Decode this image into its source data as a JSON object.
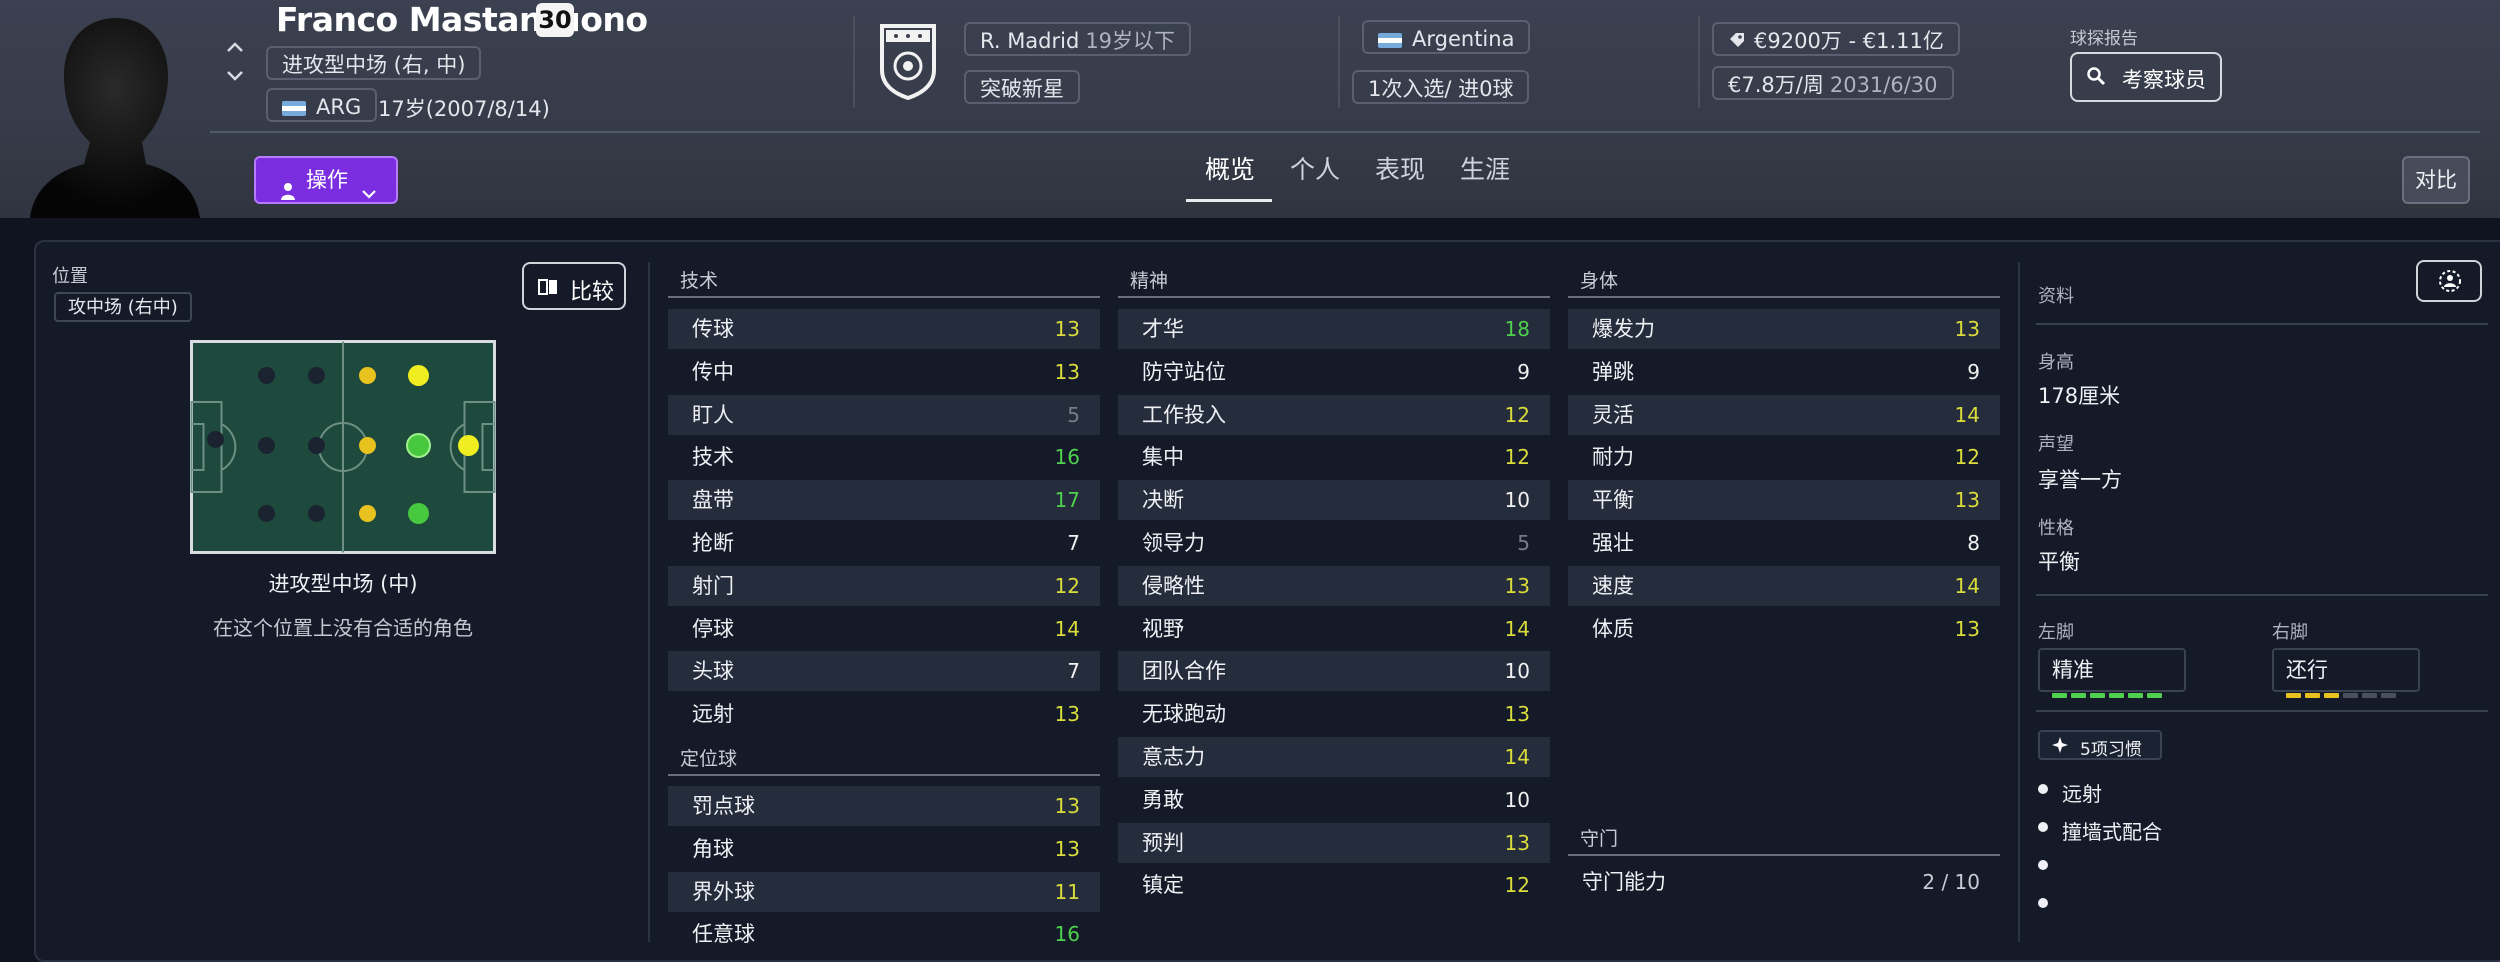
{
  "player": {
    "name": "Franco Mastantuono",
    "number": "30",
    "position": "进攻型中场 (右, 中)",
    "nationality_code": "ARG",
    "age_dob": "17岁(2007/8/14)"
  },
  "club": {
    "name": "R. Madrid",
    "squad": "19岁以下",
    "status": "突破新星"
  },
  "national": {
    "country": "Argentina",
    "caps": "1次入选/ 进0球"
  },
  "contract": {
    "value": "€9200万 - €1.11亿",
    "wage": "€7.8万/周",
    "expiry": "2031/6/30"
  },
  "scout": {
    "label": "球探报告",
    "button": "考察球员"
  },
  "actions": {
    "action_button": "操作",
    "compare_button": "对比"
  },
  "tabs": [
    "概览",
    "个人",
    "表现",
    "生涯"
  ],
  "position_panel": {
    "label": "位置",
    "current": "攻中场 (右中)",
    "compare_button": "比较",
    "role_name": "进攻型中场 (中)",
    "role_note": "在这个位置上没有合适的角色"
  },
  "technical": {
    "title": "技术",
    "items": [
      {
        "label": "传球",
        "value": "13"
      },
      {
        "label": "传中",
        "value": "13"
      },
      {
        "label": "盯人",
        "value": "5"
      },
      {
        "label": "技术",
        "value": "16"
      },
      {
        "label": "盘带",
        "value": "17"
      },
      {
        "label": "抢断",
        "value": "7"
      },
      {
        "label": "射门",
        "value": "12"
      },
      {
        "label": "停球",
        "value": "14"
      },
      {
        "label": "头球",
        "value": "7"
      },
      {
        "label": "远射",
        "value": "13"
      }
    ]
  },
  "set_pieces": {
    "title": "定位球",
    "items": [
      {
        "label": "罚点球",
        "value": "13"
      },
      {
        "label": "角球",
        "value": "13"
      },
      {
        "label": "界外球",
        "value": "11"
      },
      {
        "label": "任意球",
        "value": "16"
      }
    ]
  },
  "mental": {
    "title": "精神",
    "items": [
      {
        "label": "才华",
        "value": "18"
      },
      {
        "label": "防守站位",
        "value": "9"
      },
      {
        "label": "工作投入",
        "value": "12"
      },
      {
        "label": "集中",
        "value": "12"
      },
      {
        "label": "决断",
        "value": "10"
      },
      {
        "label": "领导力",
        "value": "5"
      },
      {
        "label": "侵略性",
        "value": "13"
      },
      {
        "label": "视野",
        "value": "14"
      },
      {
        "label": "团队合作",
        "value": "10"
      },
      {
        "label": "无球跑动",
        "value": "13"
      },
      {
        "label": "意志力",
        "value": "14"
      },
      {
        "label": "勇敢",
        "value": "10"
      },
      {
        "label": "预判",
        "value": "13"
      },
      {
        "label": "镇定",
        "value": "12"
      }
    ]
  },
  "physical": {
    "title": "身体",
    "items": [
      {
        "label": "爆发力",
        "value": "13"
      },
      {
        "label": "弹跳",
        "value": "9"
      },
      {
        "label": "灵活",
        "value": "14"
      },
      {
        "label": "耐力",
        "value": "12"
      },
      {
        "label": "平衡",
        "value": "13"
      },
      {
        "label": "强壮",
        "value": "8"
      },
      {
        "label": "速度",
        "value": "14"
      },
      {
        "label": "体质",
        "value": "13"
      }
    ]
  },
  "goalkeeping": {
    "title": "守门",
    "label": "守门能力",
    "value": "2 / 10"
  },
  "info": {
    "title": "资料",
    "height_label": "身高",
    "height": "178厘米",
    "reputation_label": "声望",
    "reputation": "享誉一方",
    "personality_label": "性格",
    "personality": "平衡",
    "left_foot_label": "左脚",
    "left_foot": "精准",
    "left_foot_level": 6,
    "right_foot_label": "右脚",
    "right_foot": "还行",
    "right_foot_level": 3,
    "traits_button": "5项习惯",
    "traits": [
      "远射",
      "撞墙式配合"
    ]
  },
  "colors": {
    "accent_purple": "#7a2ee0",
    "value_green": "#4fd14f",
    "value_yellow": "#d9dc3b"
  }
}
